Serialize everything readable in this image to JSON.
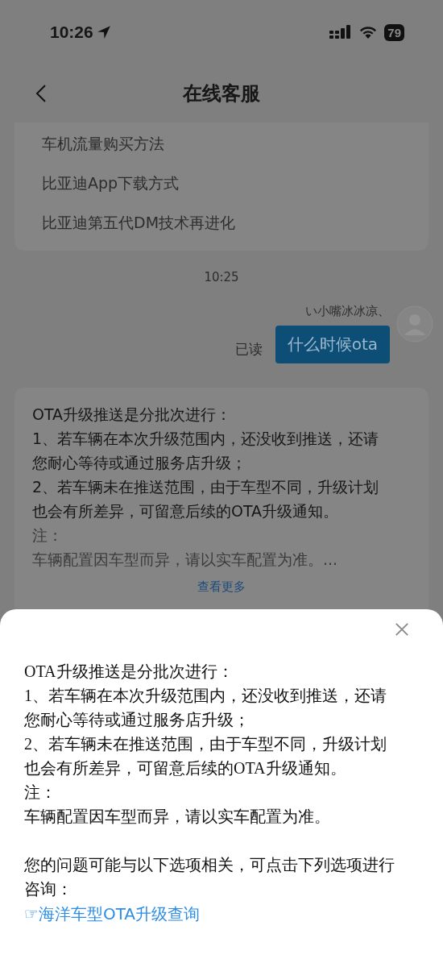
{
  "status_bar": {
    "time": "10:26",
    "battery": "79"
  },
  "nav": {
    "title": "在线客服"
  },
  "suggestions": [
    "车机流量购买方法",
    "比亚迪App下载方式",
    "比亚迪第五代DM技术再进化"
  ],
  "messages": [
    {
      "kind": "timestamp",
      "text": "10:25"
    },
    {
      "kind": "user",
      "sender": "い小嘴冰冰凉、",
      "receipt": "已读",
      "text": "什么时候ota"
    },
    {
      "kind": "bot",
      "lines": [
        {
          "text": "OTA升级推送是分批次进行：",
          "faded": false
        },
        {
          "text": "1、若车辆在本次升级范围内，还没收到推送，还请您耐心等待或通过服务店升级；",
          "faded": false
        },
        {
          "text": "2、若车辆未在推送范围，由于车型不同，升级计划也会有所差异，可留意后续的OTA升级通知。",
          "faded": false
        },
        {
          "text": "注：",
          "faded": true
        },
        {
          "text": "车辆配置因车型而异，请以实车配置为准。...",
          "faded": true
        }
      ],
      "more": "查看更多"
    }
  ],
  "sheet": {
    "paragraphs": [
      "OTA升级推送是分批次进行：",
      "1、若车辆在本次升级范围内，还没收到推送，还请您耐心等待或通过服务店升级；",
      "2、若车辆未在推送范围，由于车型不同，升级计划也会有所差异，可留意后续的OTA升级通知。",
      "注：",
      "车辆配置因车型而异，请以实车配置为准。"
    ],
    "prompt": "您的问题可能与以下选项相关，可点击下列选项进行咨询：",
    "links": [
      "☞海洋车型OTA升级查询"
    ]
  }
}
